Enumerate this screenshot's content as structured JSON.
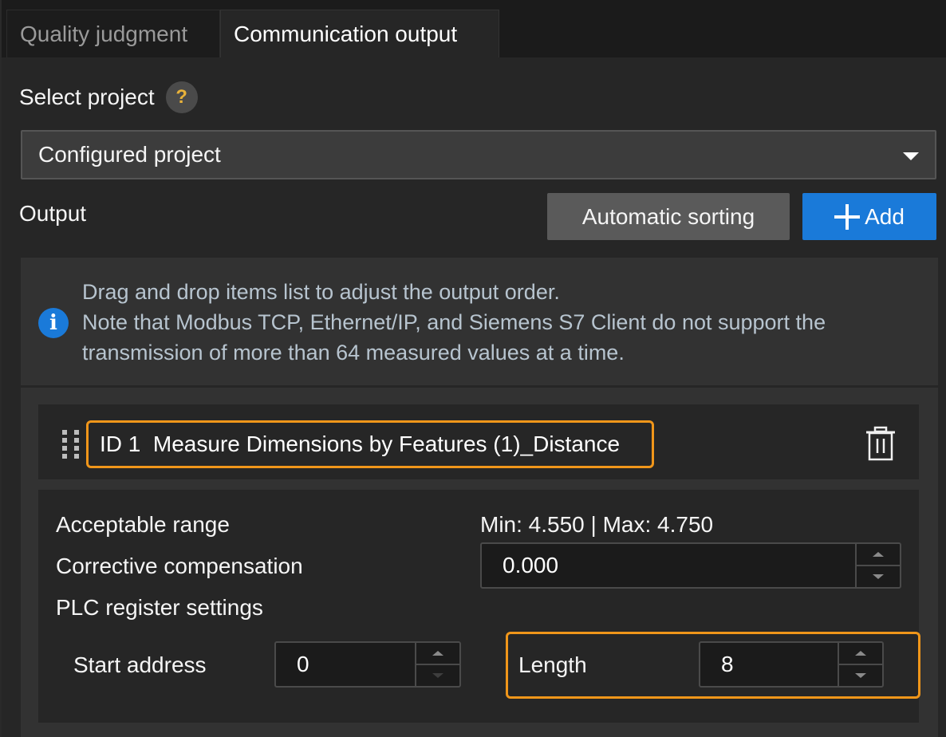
{
  "tabs": [
    {
      "label": "Quality judgment",
      "active": false
    },
    {
      "label": "Communication output",
      "active": true
    }
  ],
  "select_project": {
    "label": "Select project",
    "help_icon": "question-mark-icon",
    "dropdown_value": "Configured project"
  },
  "output": {
    "label": "Output",
    "auto_sort_label": "Automatic sorting",
    "add_label": "Add"
  },
  "info": {
    "icon": "info-icon",
    "line1": "Drag and drop items list to adjust the output order.",
    "line2": "Note that Modbus TCP, Ethernet/IP, and Siemens S7 Client do not support the",
    "line3": "transmission of more than 64 measured values at a time."
  },
  "item": {
    "title": "ID 1  Measure Dimensions by Features (1)_Distance",
    "acceptable_range_label": "Acceptable range",
    "acceptable_range_value": "Min: 4.550 | Max: 4.750",
    "compensation_label": "Corrective compensation",
    "compensation_value": "0.000",
    "plc_label": "PLC register settings",
    "start_address_label": "Start address",
    "start_address_value": "0",
    "length_label": "Length",
    "length_value": "8"
  },
  "colors": {
    "accent_blue": "#1a7ad9",
    "highlight_orange": "#f0961a",
    "help_icon_yellow": "#e8b23a"
  }
}
